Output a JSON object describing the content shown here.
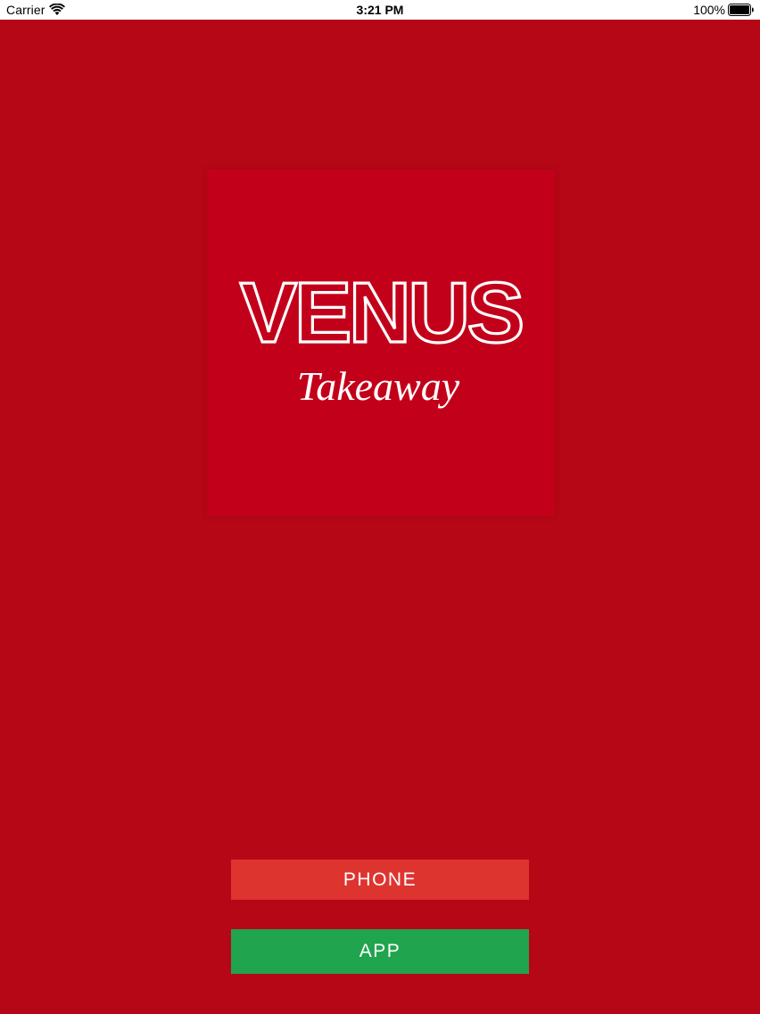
{
  "status_bar": {
    "carrier": "Carrier",
    "time": "3:21 PM",
    "battery_percent": "100%",
    "wifi_icon": "wifi-icon",
    "battery_icon": "battery-full-icon"
  },
  "logo": {
    "title": "VENUS",
    "subtitle": "Takeaway",
    "box_color": "#c3001a"
  },
  "buttons": {
    "phone": {
      "label": "PHONE",
      "color": "#de3430"
    },
    "app": {
      "label": "APP",
      "color": "#20a44d"
    }
  },
  "colors": {
    "background": "#b50716",
    "status_bar": "#ffffff"
  }
}
